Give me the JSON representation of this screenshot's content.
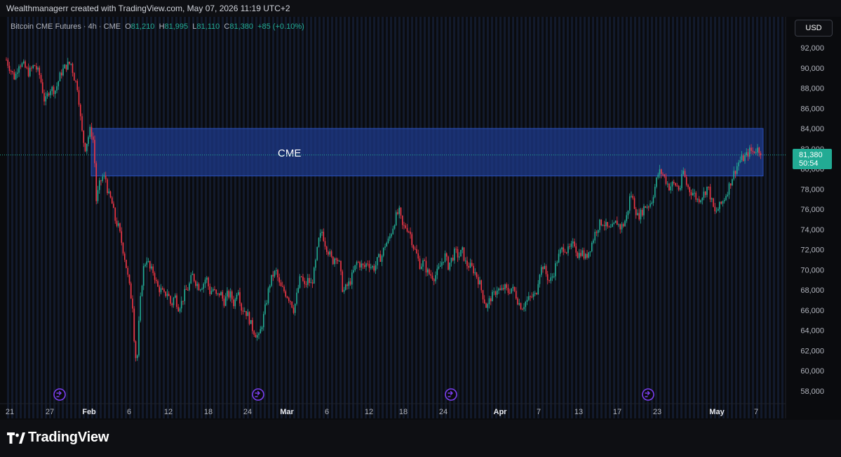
{
  "attribution": "Wealthmanagerr created with TradingView.com, May 07, 2026 11:19 UTC+2",
  "legend": {
    "symbol": "Bitcoin CME Futures · 4h · CME",
    "open_label": "O",
    "open": "81,210",
    "high_label": "H",
    "high": "81,995",
    "low_label": "L",
    "low": "81,110",
    "close_label": "C",
    "close": "81,380",
    "change": "+85 (+0.10%)"
  },
  "currency_button": "USD",
  "brand": "TradingView",
  "price_label": {
    "price": "81,380",
    "countdown": "50:54"
  },
  "colors": {
    "up": "#22ab94",
    "down": "#f23645",
    "zone": "#1e3a8a",
    "last_price_line": "#22ab94",
    "event_marker": "#7b3ff2"
  },
  "chart_data": {
    "type": "candlestick",
    "interval": "4h",
    "ylim": [
      56800,
      93200
    ],
    "y_ticks": [
      "92,000",
      "90,000",
      "88,000",
      "86,000",
      "84,000",
      "82,000",
      "80,000",
      "78,000",
      "76,000",
      "74,000",
      "72,000",
      "70,000",
      "68,000",
      "66,000",
      "64,000",
      "62,000",
      "60,000",
      "58,000"
    ],
    "x_ticks": [
      "21",
      "27",
      "Feb",
      "6",
      "12",
      "18",
      "24",
      "Mar",
      "6",
      "12",
      "18",
      "24",
      "Apr",
      "7",
      "13",
      "17",
      "23",
      "May",
      "7"
    ],
    "bold_x_ticks": [
      "Feb",
      "Mar",
      "Apr",
      "May"
    ],
    "last_price": 81380,
    "zone": {
      "label": "CME",
      "low": 79300,
      "high": 84000,
      "from": "Feb 1",
      "to": "May 7"
    },
    "event_markers": 4,
    "path": [
      [
        0,
        90800
      ],
      [
        5,
        90000
      ],
      [
        12,
        89000
      ],
      [
        18,
        90500
      ],
      [
        25,
        90200
      ],
      [
        32,
        89500
      ],
      [
        40,
        90300
      ],
      [
        48,
        89200
      ],
      [
        55,
        86500
      ],
      [
        62,
        88000
      ],
      [
        70,
        87800
      ],
      [
        78,
        89500
      ],
      [
        85,
        90200
      ],
      [
        92,
        90500
      ],
      [
        97,
        89000
      ],
      [
        102,
        88000
      ],
      [
        107,
        84000
      ],
      [
        112,
        82000
      ],
      [
        117,
        83200
      ],
      [
        120,
        84000
      ],
      [
        125,
        82500
      ],
      [
        128,
        76800
      ],
      [
        133,
        78500
      ],
      [
        137,
        79200
      ],
      [
        142,
        79000
      ],
      [
        145,
        77500
      ],
      [
        150,
        76800
      ],
      [
        155,
        75000
      ],
      [
        160,
        74200
      ],
      [
        165,
        72500
      ],
      [
        170,
        70800
      ],
      [
        175,
        68500
      ],
      [
        180,
        66500
      ],
      [
        183,
        62300
      ],
      [
        186,
        60500
      ],
      [
        190,
        66000
      ],
      [
        195,
        70000
      ],
      [
        200,
        71200
      ],
      [
        205,
        70000
      ],
      [
        210,
        69800
      ],
      [
        215,
        68300
      ],
      [
        220,
        68000
      ],
      [
        225,
        67500
      ],
      [
        230,
        67800
      ],
      [
        235,
        66400
      ],
      [
        240,
        67500
      ],
      [
        245,
        66300
      ],
      [
        250,
        66800
      ],
      [
        255,
        67800
      ],
      [
        260,
        68300
      ],
      [
        265,
        69500
      ],
      [
        270,
        68800
      ],
      [
        275,
        68300
      ],
      [
        280,
        68500
      ],
      [
        285,
        69300
      ],
      [
        290,
        67800
      ],
      [
        295,
        68100
      ],
      [
        300,
        67300
      ],
      [
        305,
        67800
      ],
      [
        310,
        66800
      ],
      [
        315,
        67500
      ],
      [
        320,
        67500
      ],
      [
        325,
        66500
      ],
      [
        330,
        68500
      ],
      [
        335,
        66200
      ],
      [
        340,
        66000
      ],
      [
        345,
        65400
      ],
      [
        350,
        64300
      ],
      [
        355,
        63700
      ],
      [
        360,
        63300
      ],
      [
        365,
        64800
      ],
      [
        370,
        66500
      ],
      [
        375,
        68500
      ],
      [
        380,
        69500
      ],
      [
        385,
        69800
      ],
      [
        390,
        68300
      ],
      [
        395,
        68000
      ],
      [
        400,
        67500
      ],
      [
        405,
        67000
      ],
      [
        410,
        66000
      ],
      [
        415,
        67800
      ],
      [
        420,
        69500
      ],
      [
        425,
        68300
      ],
      [
        430,
        69000
      ],
      [
        435,
        68500
      ],
      [
        440,
        70200
      ],
      [
        445,
        72800
      ],
      [
        450,
        73800
      ],
      [
        455,
        72500
      ],
      [
        460,
        71700
      ],
      [
        465,
        70800
      ],
      [
        470,
        71500
      ],
      [
        475,
        70500
      ],
      [
        480,
        67800
      ],
      [
        485,
        68300
      ],
      [
        490,
        68800
      ],
      [
        495,
        69800
      ],
      [
        500,
        70800
      ],
      [
        505,
        70500
      ],
      [
        510,
        70200
      ],
      [
        515,
        70800
      ],
      [
        520,
        70300
      ],
      [
        525,
        70200
      ],
      [
        530,
        71100
      ],
      [
        535,
        71300
      ],
      [
        540,
        72500
      ],
      [
        545,
        72900
      ],
      [
        550,
        74000
      ],
      [
        555,
        75200
      ],
      [
        560,
        75800
      ],
      [
        565,
        74200
      ],
      [
        570,
        74300
      ],
      [
        575,
        73800
      ],
      [
        580,
        72400
      ],
      [
        585,
        71500
      ],
      [
        590,
        70400
      ],
      [
        595,
        70800
      ],
      [
        600,
        69800
      ],
      [
        605,
        69500
      ],
      [
        610,
        69300
      ],
      [
        615,
        69800
      ],
      [
        620,
        70600
      ],
      [
        625,
        71500
      ],
      [
        630,
        70400
      ],
      [
        635,
        71100
      ],
      [
        640,
        71800
      ],
      [
        645,
        71300
      ],
      [
        650,
        71900
      ],
      [
        655,
        70600
      ],
      [
        660,
        70400
      ],
      [
        665,
        70100
      ],
      [
        670,
        69500
      ],
      [
        675,
        68600
      ],
      [
        680,
        67300
      ],
      [
        685,
        66200
      ],
      [
        690,
        67200
      ],
      [
        695,
        67500
      ],
      [
        700,
        68200
      ],
      [
        705,
        67800
      ],
      [
        710,
        68300
      ],
      [
        715,
        67800
      ],
      [
        720,
        68200
      ],
      [
        725,
        67800
      ],
      [
        730,
        66800
      ],
      [
        735,
        66300
      ],
      [
        740,
        66800
      ],
      [
        745,
        67100
      ],
      [
        750,
        67400
      ],
      [
        755,
        67500
      ],
      [
        760,
        69800
      ],
      [
        765,
        70400
      ],
      [
        770,
        69500
      ],
      [
        775,
        68800
      ],
      [
        780,
        69600
      ],
      [
        785,
        70900
      ],
      [
        790,
        71800
      ],
      [
        795,
        72300
      ],
      [
        800,
        71800
      ],
      [
        805,
        72200
      ],
      [
        810,
        72600
      ],
      [
        815,
        71400
      ],
      [
        820,
        71900
      ],
      [
        825,
        71100
      ],
      [
        830,
        71800
      ],
      [
        835,
        72700
      ],
      [
        840,
        73800
      ],
      [
        845,
        74500
      ],
      [
        850,
        74800
      ],
      [
        855,
        74300
      ],
      [
        860,
        73900
      ],
      [
        865,
        74200
      ],
      [
        870,
        74800
      ],
      [
        875,
        74200
      ],
      [
        880,
        74500
      ],
      [
        885,
        75400
      ],
      [
        890,
        77700
      ],
      [
        895,
        76500
      ],
      [
        900,
        75300
      ],
      [
        905,
        75600
      ],
      [
        910,
        76300
      ],
      [
        915,
        76400
      ],
      [
        920,
        76800
      ],
      [
        925,
        78300
      ],
      [
        930,
        79700
      ],
      [
        935,
        79600
      ],
      [
        940,
        78900
      ],
      [
        945,
        78200
      ],
      [
        950,
        78500
      ],
      [
        955,
        78400
      ],
      [
        960,
        77900
      ],
      [
        965,
        79800
      ],
      [
        970,
        78400
      ],
      [
        975,
        77800
      ],
      [
        980,
        77600
      ],
      [
        985,
        76900
      ],
      [
        990,
        77200
      ],
      [
        995,
        77600
      ],
      [
        1000,
        78300
      ],
      [
        1005,
        76900
      ],
      [
        1010,
        75600
      ],
      [
        1015,
        76100
      ],
      [
        1020,
        76600
      ],
      [
        1025,
        77300
      ],
      [
        1030,
        78200
      ],
      [
        1035,
        79200
      ],
      [
        1040,
        80000
      ],
      [
        1045,
        80800
      ],
      [
        1050,
        81000
      ],
      [
        1055,
        81300
      ],
      [
        1060,
        81800
      ],
      [
        1065,
        81700
      ],
      [
        1070,
        82000
      ],
      [
        1075,
        81800
      ],
      [
        1080,
        81500
      ],
      [
        1084,
        81380
      ]
    ]
  }
}
